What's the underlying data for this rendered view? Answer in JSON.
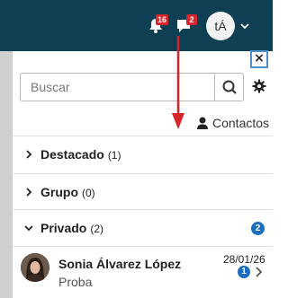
{
  "navbar": {
    "notifications_count": "16",
    "messages_count": "2",
    "user_initials": "tÁ"
  },
  "drawer": {
    "close_label": "×",
    "search": {
      "placeholder": "Buscar",
      "value": ""
    },
    "contacts_label": "Contactos",
    "sections": [
      {
        "title": "Destacado",
        "count": "(1)",
        "expanded": false
      },
      {
        "title": "Grupo",
        "count": "(0)",
        "expanded": false
      },
      {
        "title": "Privado",
        "count": "(2)",
        "expanded": true,
        "badge": "2"
      }
    ],
    "conversations": [
      {
        "name": "Sonia Álvarez López",
        "preview": "Proba",
        "date": "28/01/26",
        "unread": "1"
      }
    ]
  },
  "icons": {
    "bell": "bell-icon",
    "chat": "chat-bubble-icon",
    "search": "search-icon",
    "settings": "gear-icon",
    "contacts": "person-icon",
    "chevron": "chevron-icon"
  },
  "colors": {
    "navbar": "#0f3f53",
    "badge_red": "#d8242c",
    "badge_blue": "#1a6dbf",
    "arrow_annotation": "#d9232a"
  }
}
